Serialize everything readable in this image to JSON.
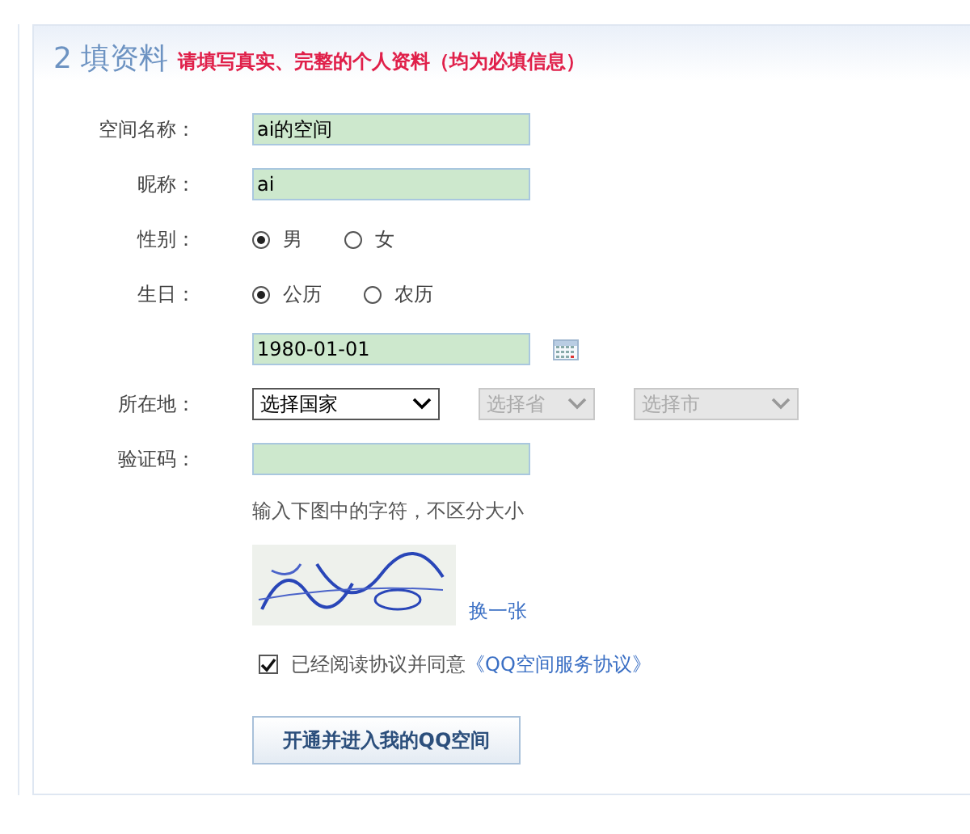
{
  "header": {
    "step": "2",
    "title": "填资料",
    "note": "请填写真实、完整的个人资料（均为必填信息）"
  },
  "rows": [
    {
      "kind": "text",
      "label": "空间名称：",
      "value": "ai的空间"
    },
    {
      "kind": "text",
      "label": "昵称：",
      "value": "ai"
    },
    {
      "kind": "radio",
      "label": "性别：",
      "options": [
        {
          "label": "男",
          "selected": true
        },
        {
          "label": "女",
          "selected": false
        }
      ]
    },
    {
      "kind": "radio",
      "label": "生日：",
      "options": [
        {
          "label": "公历",
          "selected": true
        },
        {
          "label": "农历",
          "selected": false
        }
      ]
    },
    {
      "kind": "date",
      "value": "1980-01-01"
    },
    {
      "kind": "selects",
      "label": "所在地：",
      "selects": [
        {
          "value": "选择国家",
          "disabled": false
        },
        {
          "value": "选择省",
          "disabled": true
        },
        {
          "value": "选择市",
          "disabled": true
        }
      ]
    },
    {
      "kind": "text",
      "label": "验证码："
    }
  ],
  "captcha": {
    "hint": "输入下图中的字符，不区分大小",
    "refresh": "换一张"
  },
  "agreement": {
    "checked": true,
    "text": "已经阅读协议并同意",
    "link": "《QQ空间服务协议》"
  },
  "submit": "开通并进入我的QQ空间"
}
